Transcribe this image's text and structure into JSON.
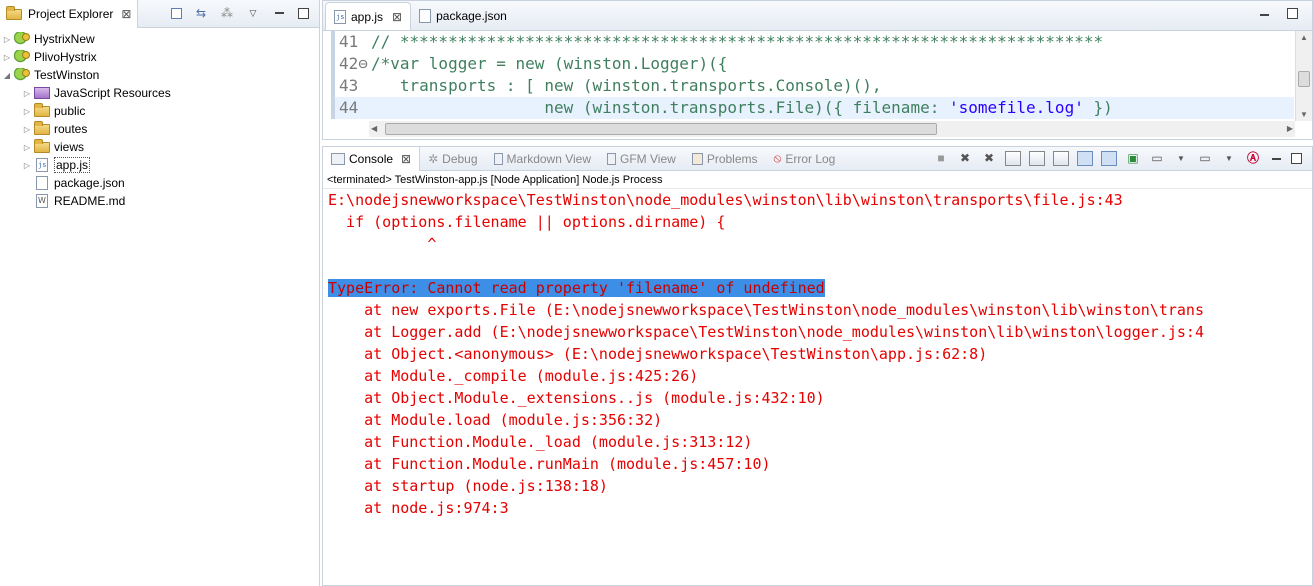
{
  "explorer": {
    "title": "Project Explorer",
    "tree": [
      {
        "label": "HystrixNew",
        "kind": "project",
        "twisty": "▷",
        "indent": 0
      },
      {
        "label": "PlivoHystrix",
        "kind": "project",
        "twisty": "▷",
        "indent": 0
      },
      {
        "label": "TestWinston",
        "kind": "project",
        "twisty": "◢",
        "indent": 0
      },
      {
        "label": "JavaScript Resources",
        "kind": "jslib",
        "twisty": "▷",
        "indent": 1
      },
      {
        "label": "public",
        "kind": "folder",
        "twisty": "▷",
        "indent": 1
      },
      {
        "label": "routes",
        "kind": "folder",
        "twisty": "▷",
        "indent": 1
      },
      {
        "label": "views",
        "kind": "folder",
        "twisty": "▷",
        "indent": 1
      },
      {
        "label": "app.js",
        "kind": "jsfile",
        "twisty": "▷",
        "indent": 1
      },
      {
        "label": "package.json",
        "kind": "file",
        "twisty": "",
        "indent": 1
      },
      {
        "label": "README.md",
        "kind": "wfile",
        "twisty": "",
        "indent": 1
      }
    ]
  },
  "editor": {
    "tabs": [
      {
        "label": "app.js",
        "active": true
      },
      {
        "label": "package.json",
        "active": false
      }
    ],
    "lines": [
      {
        "num": "41",
        "text": "// *************************************************************************",
        "kind": "comment"
      },
      {
        "num": "42⊖",
        "text": "/*var logger = new (winston.Logger)({",
        "kind": "code"
      },
      {
        "num": "43",
        "text": "   transports : [ new (winston.transports.Console)(),",
        "kind": "code"
      },
      {
        "num": "44",
        "text": "                  new (winston.transports.File)({ filename: 'somefile.log' })",
        "kind": "code"
      }
    ]
  },
  "console": {
    "tabs": [
      "Console",
      "Debug",
      "Markdown View",
      "GFM View",
      "Problems",
      "Error Log"
    ],
    "description": "<terminated> TestWinston-app.js [Node Application] Node.js Process",
    "output": [
      "E:\\nodejsnewworkspace\\TestWinston\\node_modules\\winston\\lib\\winston\\transports\\file.js:43",
      "  if (options.filename || options.dirname) {",
      "           ^",
      "",
      "TypeError: Cannot read property 'filename' of undefined",
      "    at new exports.File (E:\\nodejsnewworkspace\\TestWinston\\node_modules\\winston\\lib\\winston\\trans",
      "    at Logger.add (E:\\nodejsnewworkspace\\TestWinston\\node_modules\\winston\\lib\\winston\\logger.js:4",
      "    at Object.<anonymous> (E:\\nodejsnewworkspace\\TestWinston\\app.js:62:8)",
      "    at Module._compile (module.js:425:26)",
      "    at Object.Module._extensions..js (module.js:432:10)",
      "    at Module.load (module.js:356:32)",
      "    at Function.Module._load (module.js:313:12)",
      "    at Function.Module.runMain (module.js:457:10)",
      "    at startup (node.js:138:18)",
      "    at node.js:974:3"
    ],
    "highlighted_line": 4
  },
  "colors": {
    "error_text": "#e60000",
    "selection": "#3d8ee6",
    "comment": "#3f7f5f",
    "string": "#2a00ff"
  }
}
